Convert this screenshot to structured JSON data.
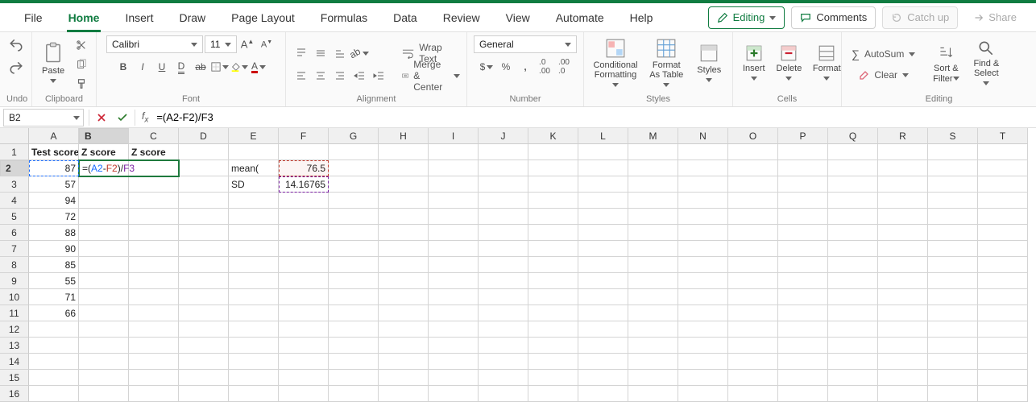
{
  "tabs": {
    "items": [
      "File",
      "Home",
      "Insert",
      "Draw",
      "Page Layout",
      "Formulas",
      "Data",
      "Review",
      "View",
      "Automate",
      "Help"
    ],
    "active_index": 1,
    "editing": "Editing",
    "comments": "Comments",
    "catchup": "Catch up",
    "share": "Share"
  },
  "ribbon": {
    "undo_label": "Undo",
    "paste": "Paste",
    "clipboard_label": "Clipboard",
    "font_name": "Calibri",
    "font_size": "11",
    "font_label": "Font",
    "wrap": "Wrap Text",
    "merge": "Merge & Center",
    "alignment_label": "Alignment",
    "number_format": "General",
    "number_label": "Number",
    "cond_fmt": "Conditional Formatting",
    "fmt_table": "Format As Table",
    "styles": "Styles",
    "styles_label": "Styles",
    "insert": "Insert",
    "delete": "Delete",
    "format": "Format",
    "cells_label": "Cells",
    "autosum": "AutoSum",
    "clear": "Clear",
    "sortfilter": "Sort & Filter",
    "findselect": "Find & Select",
    "editing_label": "Editing"
  },
  "fxbar": {
    "cell_ref": "B2",
    "formula": "=(A2-F2)/F3",
    "formula_tokens": [
      "=(",
      "A2",
      "-",
      "F2",
      ")/",
      "F3"
    ]
  },
  "grid": {
    "columns": [
      "A",
      "B",
      "C",
      "D",
      "E",
      "F",
      "G",
      "H",
      "I",
      "J",
      "K",
      "L",
      "M",
      "N",
      "O",
      "P",
      "Q",
      "R",
      "S",
      "T"
    ],
    "active_col_index": 1,
    "active_row_index": 1,
    "row_count": 16,
    "headers": {
      "A1": "Test score",
      "B1": "Z score",
      "C1": "Z score"
    },
    "data": {
      "A": [
        "87",
        "57",
        "94",
        "72",
        "88",
        "90",
        "85",
        "55",
        "71",
        "66"
      ],
      "E2": "mean(",
      "E3": "SD",
      "F2": "76.5",
      "F3": "14.16765"
    },
    "edit_cell": "B2",
    "edit_span_cols": 2
  },
  "icons": {
    "undo": "undo-icon",
    "redo": "redo-icon",
    "clipboard": "clipboard-icon",
    "paintfmt": "brush-icon",
    "cut": "scissors-icon",
    "bold": "bold-icon",
    "italic": "italic-icon",
    "underline": "underline-icon",
    "dunderline": "double-underline-icon",
    "strike": "strike-icon"
  }
}
